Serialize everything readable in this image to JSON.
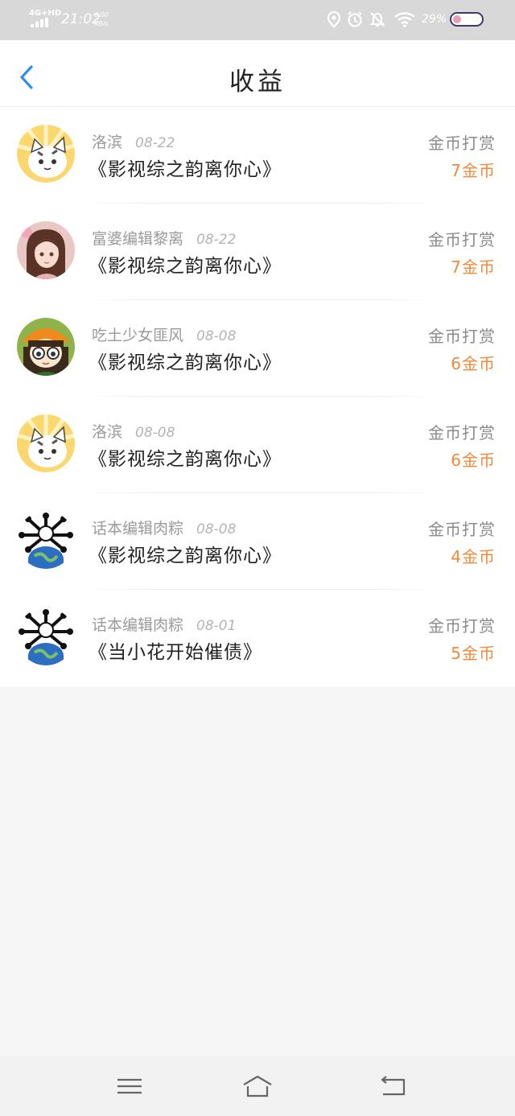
{
  "status_bar": {
    "network": "4G+HD",
    "time": "21:02",
    "speed_value": "8.00",
    "speed_unit": "KB/s",
    "battery_percent": "29%",
    "battery_level": 0.29,
    "icons": [
      "signal-icon",
      "location-icon",
      "alarm-icon",
      "mute-icon",
      "wifi-icon",
      "battery-icon"
    ]
  },
  "header": {
    "title": "收益",
    "back_icon": "chevron-left-icon",
    "accent_color": "#2e8ff0"
  },
  "records": [
    {
      "avatar": "cat-avatar",
      "user": "洛滨",
      "date": "08-22",
      "book": "《影视综之韵离你心》",
      "type": "金币打赏",
      "amount": "7金币"
    },
    {
      "avatar": "girl-avatar",
      "user": "富婆编辑黎离",
      "date": "08-22",
      "book": "《影视综之韵离你心》",
      "type": "金币打赏",
      "amount": "7金币"
    },
    {
      "avatar": "glasses-girl-avatar",
      "user": "吃土少女匪风",
      "date": "08-08",
      "book": "《影视综之韵离你心》",
      "type": "金币打赏",
      "amount": "6金币"
    },
    {
      "avatar": "cat-avatar",
      "user": "洛滨",
      "date": "08-08",
      "book": "《影视综之韵离你心》",
      "type": "金币打赏",
      "amount": "6金币"
    },
    {
      "avatar": "globe-bones-avatar",
      "user": "话本编辑肉粽",
      "date": "08-08",
      "book": "《影视综之韵离你心》",
      "type": "金币打赏",
      "amount": "4金币"
    },
    {
      "avatar": "globe-bones-avatar",
      "user": "话本编辑肉粽",
      "date": "08-01",
      "book": "《当小花开始催债》",
      "type": "金币打赏",
      "amount": "5金币"
    }
  ],
  "nav_bar": {
    "buttons": [
      "menu-icon",
      "home-icon",
      "back-icon"
    ]
  },
  "colors": {
    "amount": "#ee8a3c",
    "status_bar_bg": "#d8d8d8",
    "page_bg": "#f7f6f7"
  }
}
